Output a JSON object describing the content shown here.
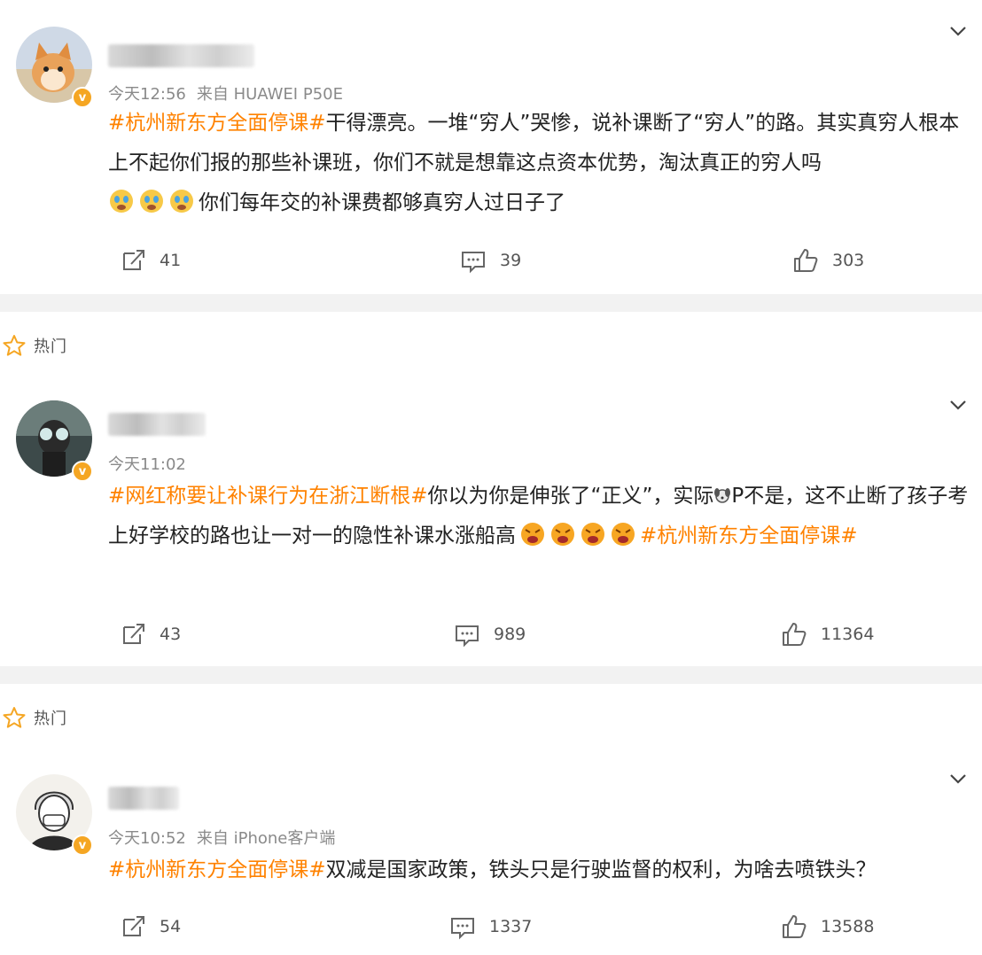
{
  "posts": [
    {
      "time": "今天12:56",
      "source": "来自 HUAWEI P50E",
      "tag1": "#杭州新东方全面停课#",
      "text": "干得漂亮。一堆“穷人”哭惨，说补课断了“穷人”的路。其实真穷人根本上不起你们报的那些补课班，你们不就是想靠这点资本优势，淘汰真正的穷人吗",
      "text2": "你们每年交的补课费都够真穷人过日子了",
      "emoji": "crying-face",
      "repost": "41",
      "comment": "39",
      "like": "303"
    },
    {
      "hot_label": "热门",
      "time": "今天11:02",
      "tag1": "#网红称要让补课行为在浙江断根#",
      "text_a": "你以为你是伸张了“正义”，实际",
      "text_b": "P不是，这不止断了孩子考上好学校的路也让一对一的隐性补课水涨船高",
      "tag2": "#杭州新东方全面停课#",
      "emoji": "angry-face",
      "repost": "43",
      "comment": "989",
      "like": "11364"
    },
    {
      "hot_label": "热门",
      "time": "今天10:52",
      "source": "来自 iPhone客户端",
      "tag1": "#杭州新东方全面停课#",
      "text": "双减是国家政策，铁头只是行驶监督的权利，为啥去喷铁头？",
      "repost": "54",
      "comment": "1337",
      "like": "13588"
    }
  ],
  "colors": {
    "tag": "#ff8200",
    "meta": "#8a8a8a",
    "badge": "#f5a623",
    "separator": "#f2f2f2"
  },
  "icons": [
    "chevron-down-icon",
    "repost-icon",
    "comment-icon",
    "like-icon",
    "star-icon",
    "verified-badge-icon"
  ]
}
